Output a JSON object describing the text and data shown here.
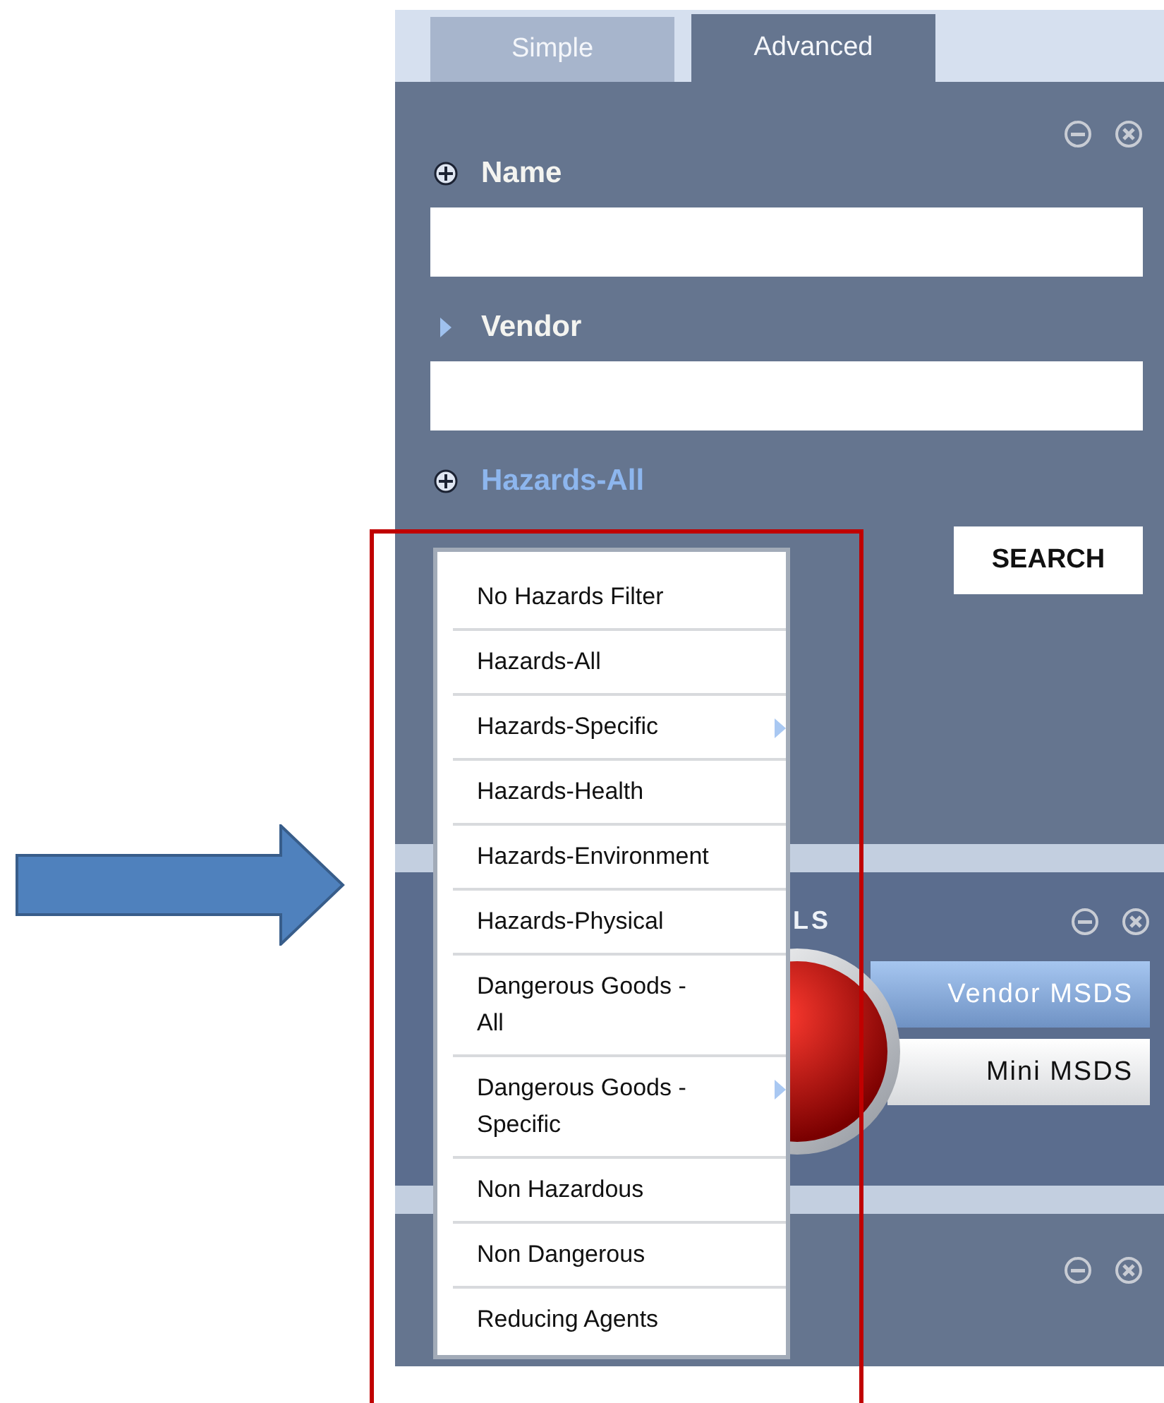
{
  "tabs": [
    {
      "label": "Simple",
      "selected": false
    },
    {
      "label": "Advanced",
      "selected": true
    }
  ],
  "search_panel": {
    "filters": [
      {
        "label": "Name",
        "kind": "field"
      },
      {
        "label": "Vendor",
        "kind": "toggle-field"
      },
      {
        "label": "Hazards-All",
        "kind": "menu"
      }
    ],
    "search_button": "SEARCH"
  },
  "hazards_menu": [
    {
      "label": "No Hazards Filter",
      "submenu": false
    },
    {
      "label": "Hazards-All",
      "submenu": false
    },
    {
      "label": "Hazards-Specific",
      "submenu": true
    },
    {
      "label": "Hazards-Health",
      "submenu": false
    },
    {
      "label": "Hazards-Environment",
      "submenu": false
    },
    {
      "label": "Hazards-Physical",
      "submenu": false
    },
    {
      "label": "Dangerous Goods - All",
      "submenu": false
    },
    {
      "label": "Dangerous Goods - Specific",
      "submenu": true
    },
    {
      "label": "Non Hazardous",
      "submenu": false
    },
    {
      "label": "Non Dangerous",
      "submenu": false
    },
    {
      "label": "Reducing Agents",
      "submenu": false
    }
  ],
  "documents_panel": {
    "title": "LS",
    "buttons": [
      {
        "label": "Vendor MSDS",
        "selected": true
      },
      {
        "label": "Mini MSDS",
        "selected": false
      }
    ]
  }
}
